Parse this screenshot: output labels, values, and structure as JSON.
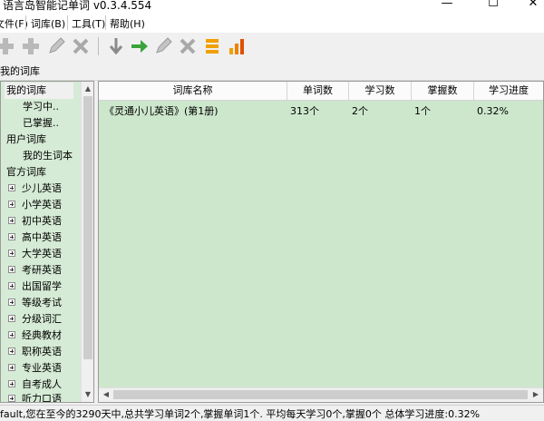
{
  "window": {
    "title": "语言岛智能记单词 v0.3.4.554",
    "minimize": "—",
    "maximize": "☐",
    "close": "✕"
  },
  "menu": {
    "file": "文件(F)",
    "dict": "词库(B)",
    "tools": "工具(T)",
    "help": "帮助(H)"
  },
  "toolbar": {
    "icons": [
      "plus-icon",
      "plus-icon",
      "pencil-icon",
      "delete-icon",
      "import-icon",
      "export-icon",
      "pencil-icon",
      "delete-icon",
      "stack-icon",
      "bar-chart-icon"
    ]
  },
  "path": "我的词库",
  "sidebar": {
    "items": [
      {
        "label": "我的词库"
      },
      {
        "label": "学习中.."
      },
      {
        "label": "已掌握.."
      },
      {
        "label": "用户词库"
      },
      {
        "label": "我的生词本"
      },
      {
        "label": "官方词库"
      },
      {
        "label": "少儿英语"
      },
      {
        "label": "小学英语"
      },
      {
        "label": "初中英语"
      },
      {
        "label": "高中英语"
      },
      {
        "label": "大学英语"
      },
      {
        "label": "考研英语"
      },
      {
        "label": "出国留学"
      },
      {
        "label": "等级考试"
      },
      {
        "label": "分级词汇"
      },
      {
        "label": "经典教材"
      },
      {
        "label": "职称英语"
      },
      {
        "label": "专业英语"
      },
      {
        "label": "自考成人"
      },
      {
        "label": "听力口语"
      }
    ]
  },
  "table": {
    "headers": [
      "词库名称",
      "单词数",
      "学习数",
      "掌握数",
      "学习进度"
    ],
    "rows": [
      [
        "《灵通小儿英语》(第1册)",
        "313个",
        "2个",
        "1个",
        "0.32%"
      ]
    ]
  },
  "status": "fault,您在至今的3290天中,总共学习单词2个,掌握单词1个. 平均每天学习0个,掌握0个 总体学习进度:0.32%",
  "colors": {
    "pane": "#cde7cd",
    "sidebar": "#d6ebd6"
  }
}
